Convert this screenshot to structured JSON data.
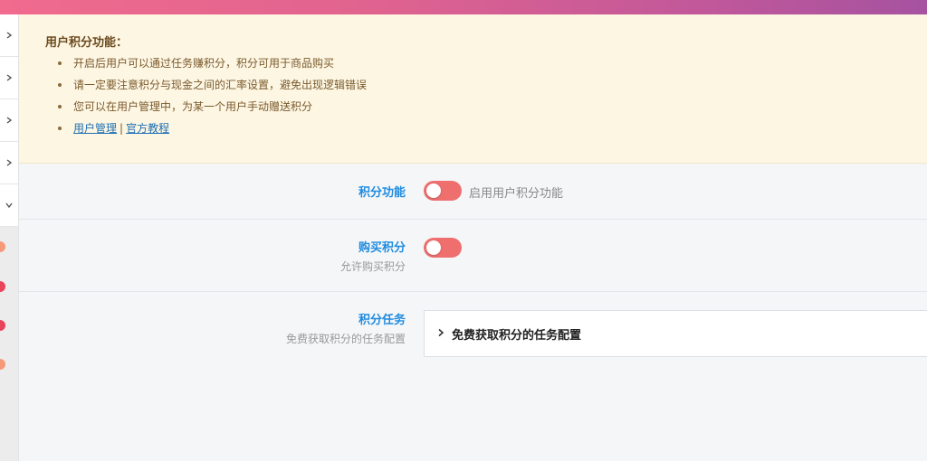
{
  "notice": {
    "title": "用户积分功能：",
    "bullets": [
      "开启后用户可以通过任务赚积分，积分可用于商品购买",
      "请一定要注意积分与现金之间的汇率设置，避免出现逻辑错误",
      "您可以在用户管理中，为某一个用户手动赠送积分"
    ],
    "links": {
      "user_manage": "用户管理",
      "separator": "|",
      "official_tutorial": "官方教程"
    }
  },
  "settings": {
    "points_feature": {
      "label": "积分功能",
      "toggle_text": "启用用户积分功能",
      "enabled": false
    },
    "buy_points": {
      "label": "购买积分",
      "sublabel": "允许购买积分",
      "enabled": false
    },
    "points_tasks": {
      "label": "积分任务",
      "sublabel": "免费获取积分的任务配置",
      "panel_title": "免费获取积分的任务配置"
    }
  },
  "colors": {
    "accent_blue": "#1f8ce0",
    "toggle_off": "#ef6f6f",
    "notice_bg": "#fdf6e3"
  }
}
